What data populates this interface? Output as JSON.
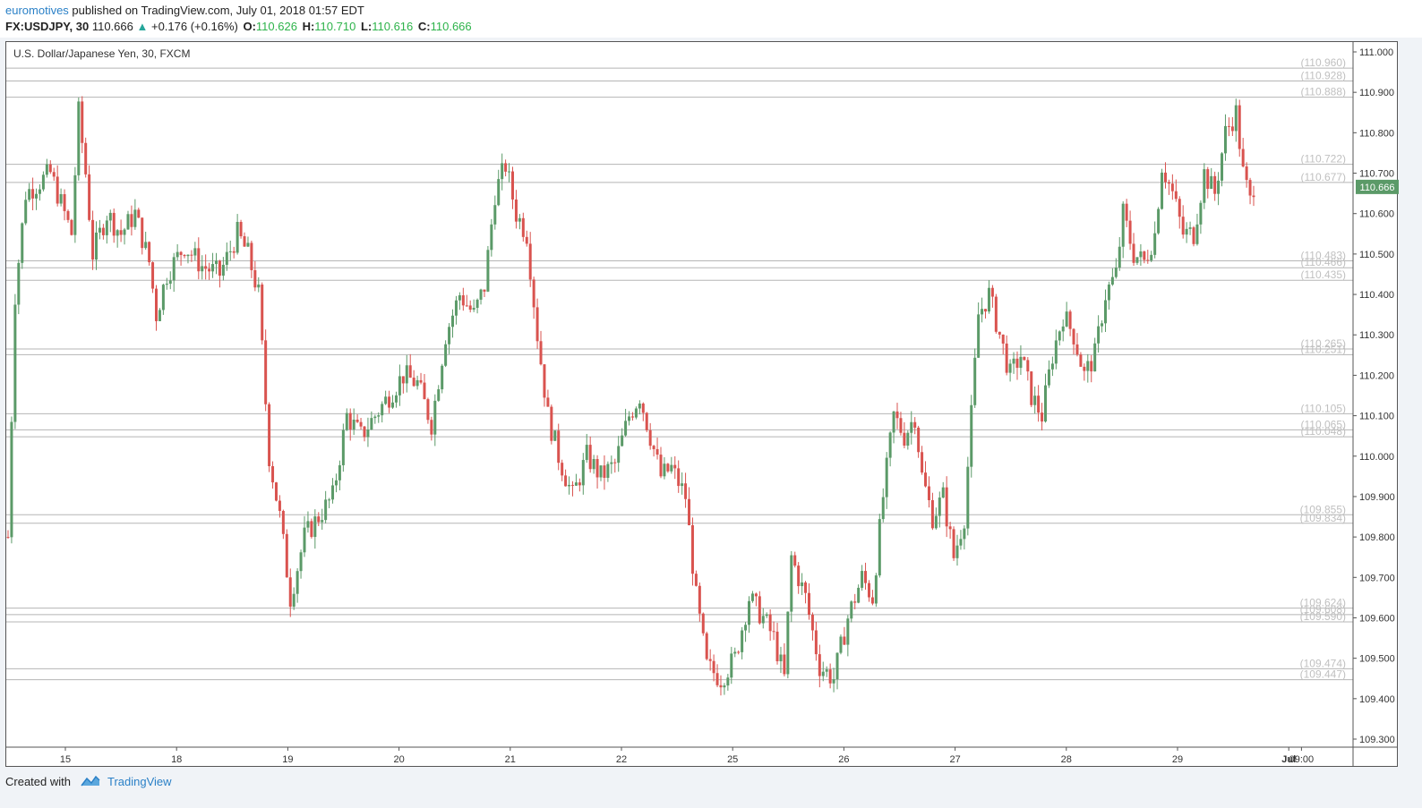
{
  "header": {
    "author": "euromotives",
    "published": " published on TradingView.com, July 01, 2018 01:57 EDT",
    "symbol": "FX:USDJPY, 30",
    "last": "110.666",
    "arrow": "▲",
    "change": "+0.176 (+0.16%)",
    "o_label": "O:",
    "o_value": "110.626",
    "h_label": "H:",
    "h_value": "110.710",
    "l_label": "L:",
    "l_value": "110.616",
    "c_label": "C:",
    "c_value": "110.666"
  },
  "footer": {
    "created_with": "Created with",
    "brand": "TradingView"
  },
  "colors": {
    "up": "#5b9a68",
    "down": "#d9534f",
    "price_tag": "#5b9a68",
    "level_line": "#b5b5b5",
    "level_label": "#c0c0c0",
    "axis_text": "#333333",
    "author_link": "#2a80c7",
    "ohlc_value": "#2db34a"
  },
  "chart_data": {
    "type": "candlestick",
    "title": "U.S. Dollar/Japanese Yen, 30, FXCM",
    "ylim": [
      109.3,
      111.0
    ],
    "y_ticks": [
      "111.000",
      "110.900",
      "110.800",
      "110.700",
      "110.600",
      "110.500",
      "110.400",
      "110.300",
      "110.200",
      "110.100",
      "110.000",
      "109.900",
      "109.800",
      "109.700",
      "109.600",
      "109.500",
      "109.400",
      "109.300"
    ],
    "x_ticks": [
      "15",
      "18",
      "19",
      "20",
      "21",
      "22",
      "25",
      "26",
      "27",
      "28",
      "29",
      "Jul",
      "09:00"
    ],
    "last_price": "110.666",
    "levels": [
      "110.960",
      "110.928",
      "110.888",
      "110.722",
      "110.677",
      "110.483",
      "110.466",
      "110.435",
      "110.265",
      "110.251",
      "110.105",
      "110.065",
      "110.048",
      "109.855",
      "109.834",
      "109.624",
      "109.608",
      "109.590",
      "109.474",
      "109.447"
    ],
    "series_anchors": [
      [
        0,
        109.8
      ],
      [
        2,
        110.4
      ],
      [
        5,
        110.65
      ],
      [
        12,
        110.7
      ],
      [
        16,
        110.6
      ],
      [
        18,
        110.55
      ],
      [
        20,
        110.85
      ],
      [
        22,
        110.7
      ],
      [
        24,
        110.5
      ],
      [
        28,
        110.6
      ],
      [
        32,
        110.55
      ],
      [
        36,
        110.6
      ],
      [
        40,
        110.48
      ],
      [
        42,
        110.35
      ],
      [
        45,
        110.45
      ],
      [
        50,
        110.52
      ],
      [
        55,
        110.47
      ],
      [
        60,
        110.45
      ],
      [
        65,
        110.55
      ],
      [
        68,
        110.5
      ],
      [
        71,
        110.4
      ],
      [
        74,
        110.0
      ],
      [
        77,
        109.85
      ],
      [
        80,
        109.65
      ],
      [
        84,
        109.8
      ],
      [
        88,
        109.85
      ],
      [
        92,
        109.9
      ],
      [
        96,
        110.1
      ],
      [
        100,
        110.05
      ],
      [
        104,
        110.1
      ],
      [
        108,
        110.15
      ],
      [
        112,
        110.2
      ],
      [
        116,
        110.18
      ],
      [
        120,
        110.08
      ],
      [
        124,
        110.3
      ],
      [
        128,
        110.4
      ],
      [
        132,
        110.35
      ],
      [
        135,
        110.42
      ],
      [
        138,
        110.65
      ],
      [
        141,
        110.72
      ],
      [
        144,
        110.6
      ],
      [
        147,
        110.55
      ],
      [
        150,
        110.3
      ],
      [
        153,
        110.1
      ],
      [
        156,
        110.0
      ],
      [
        160,
        109.9
      ],
      [
        164,
        110.0
      ],
      [
        168,
        109.95
      ],
      [
        172,
        109.98
      ],
      [
        176,
        110.1
      ],
      [
        179,
        110.15
      ],
      [
        182,
        110.05
      ],
      [
        185,
        109.95
      ],
      [
        188,
        109.97
      ],
      [
        192,
        109.9
      ],
      [
        195,
        109.65
      ],
      [
        198,
        109.48
      ],
      [
        202,
        109.45
      ],
      [
        206,
        109.5
      ],
      [
        210,
        109.65
      ],
      [
        214,
        109.6
      ],
      [
        217,
        109.55
      ],
      [
        220,
        109.45
      ],
      [
        222,
        109.75
      ],
      [
        226,
        109.65
      ],
      [
        230,
        109.48
      ],
      [
        234,
        109.45
      ],
      [
        238,
        109.6
      ],
      [
        242,
        109.7
      ],
      [
        245,
        109.65
      ],
      [
        248,
        109.9
      ],
      [
        251,
        110.1
      ],
      [
        254,
        110.05
      ],
      [
        257,
        110.1
      ],
      [
        259,
        109.95
      ],
      [
        262,
        109.85
      ],
      [
        265,
        109.9
      ],
      [
        268,
        109.75
      ],
      [
        271,
        109.85
      ],
      [
        273,
        110.1
      ],
      [
        275,
        110.35
      ],
      [
        278,
        110.4
      ],
      [
        281,
        110.3
      ],
      [
        284,
        110.2
      ],
      [
        287,
        110.25
      ],
      [
        290,
        110.15
      ],
      [
        293,
        110.1
      ],
      [
        296,
        110.25
      ],
      [
        299,
        110.35
      ],
      [
        302,
        110.3
      ],
      [
        305,
        110.2
      ],
      [
        308,
        110.25
      ],
      [
        311,
        110.4
      ],
      [
        314,
        110.45
      ],
      [
        316,
        110.6
      ],
      [
        319,
        110.5
      ],
      [
        322,
        110.48
      ],
      [
        325,
        110.55
      ],
      [
        327,
        110.72
      ],
      [
        330,
        110.65
      ],
      [
        333,
        110.55
      ],
      [
        336,
        110.55
      ],
      [
        339,
        110.7
      ],
      [
        342,
        110.65
      ],
      [
        345,
        110.8
      ],
      [
        348,
        110.85
      ],
      [
        350,
        110.7
      ],
      [
        352,
        110.63
      ],
      [
        353,
        110.67
      ]
    ]
  }
}
